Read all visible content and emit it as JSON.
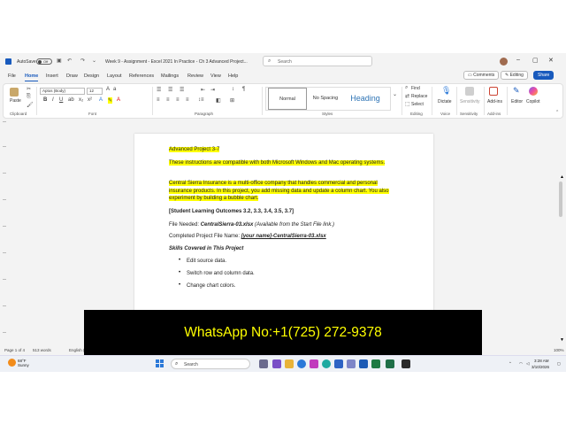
{
  "titlebar": {
    "autosave_label": "AutoSave",
    "autosave_state": "Off",
    "doc_title": "Week 9 - Assignment - Excel 2021 In Practice - Ch 3 Advanced Project...",
    "search_placeholder": "Search"
  },
  "menu": {
    "tabs": [
      "File",
      "Home",
      "Insert",
      "Draw",
      "Design",
      "Layout",
      "References",
      "Mailings",
      "Review",
      "View",
      "Help"
    ],
    "active_tab": "Home",
    "comments_label": "Comments",
    "editing_label": "Editing",
    "share_label": "Share"
  },
  "ribbon": {
    "font_name": "Aptos (Body)",
    "font_size": "12",
    "paste_label": "Paste",
    "style_normal": "Normal",
    "style_nospacing": "No Spacing",
    "style_heading": "Heading",
    "find_label": "Find",
    "replace_label": "Replace",
    "select_label": "Select",
    "dictate_label": "Dictate",
    "sensitivity_label": "Sensitivity",
    "addins_label": "Add-ins",
    "editor_label": "Editor",
    "copilot_label": "Copilot",
    "groups": {
      "clipboard": "Clipboard",
      "font": "Font",
      "paragraph": "Paragraph",
      "styles": "Styles",
      "editing": "Editing",
      "voice": "Voice",
      "sensitivity": "Sensitivity",
      "addins": "Add-ins"
    }
  },
  "document": {
    "title": "Advanced Project 3-7",
    "compat": "These instructions are compatible with both Microsoft Windows and Mac operating systems.",
    "intro": "Central Sierra Insurance is a multi-office company that handles commercial and personal insurance products. In this project, you add missing data and update a column chart. You also experiment by building a bubble chart.",
    "outcomes": "[Student Learning Outcomes 3.2, 3.3, 3.4, 3.5, 3.7]",
    "file_needed_label": "File Needed: ",
    "file_needed_name": "CentralSierra-03.xlsx",
    "file_needed_note": " (Available from the Start File link.)",
    "completed_label": "Completed Project File Name: ",
    "completed_name": "[your name]-CentralSierra-03.xlsx",
    "skills_heading": "Skills Covered in This Project",
    "skills": [
      "Edit source data.",
      "Switch row and column data.",
      "Change chart colors."
    ]
  },
  "statusbar": {
    "page": "Page 1 of 4",
    "words": "513 words",
    "language": "English (United States)",
    "zoom": "100%"
  },
  "overlay_text": "WhatsApp No:+1(725) 272-9378",
  "taskbar": {
    "temperature": "68°F",
    "condition": "Sunny",
    "search_placeholder": "Search",
    "time": "3:28 AM",
    "date": "3/10/2026"
  }
}
